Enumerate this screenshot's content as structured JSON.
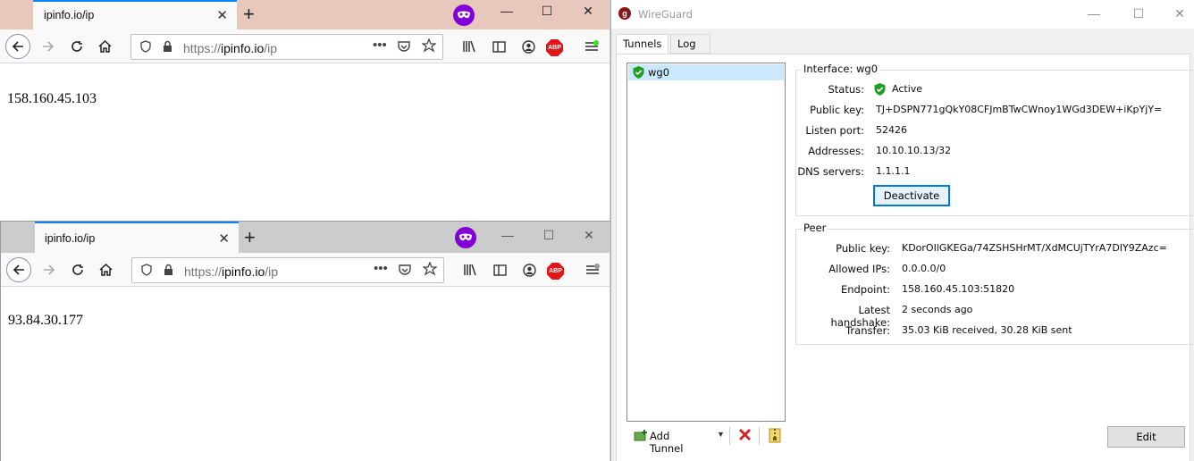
{
  "firefox_top": {
    "tab_title": "ipinfo.io/ip",
    "url_prefix": "https://",
    "url_host": "ipinfo.io",
    "url_path": "/ip",
    "page_content": "158.160.45.103",
    "abp_label": "ABP"
  },
  "firefox_bottom": {
    "tab_title": "ipinfo.io/ip",
    "url_prefix": "https://",
    "url_host": "ipinfo.io",
    "url_path": "/ip",
    "page_content": "93.84.30.177",
    "abp_label": "ABP"
  },
  "wireguard": {
    "title": "WireGuard",
    "tabs": [
      "Tunnels",
      "Log"
    ],
    "tunnels": [
      {
        "name": "wg0",
        "active": true
      }
    ],
    "interface": {
      "title": "Interface: wg0",
      "status_label": "Status:",
      "status_value": "Active",
      "public_key_label": "Public key:",
      "public_key": "TJ+DSPN771gQkY08CFJmBTwCWnoy1WGd3DEW+iKpYjY=",
      "listen_port_label": "Listen port:",
      "listen_port": "52426",
      "addresses_label": "Addresses:",
      "addresses": "10.10.10.13/32",
      "dns_label": "DNS servers:",
      "dns": "1.1.1.1",
      "deactivate_label": "Deactivate"
    },
    "peer": {
      "title": "Peer",
      "public_key_label": "Public key:",
      "public_key": "KDorOIlGKEGa/74ZSHSHrMT/XdMCUjTYrA7DIY9ZAzc=",
      "allowed_ips_label": "Allowed IPs:",
      "allowed_ips": "0.0.0.0/0",
      "endpoint_label": "Endpoint:",
      "endpoint": "158.160.45.103:51820",
      "handshake_label": "Latest handshake:",
      "handshake": "2 seconds ago",
      "transfer_label": "Transfer:",
      "transfer": "35.03 KiB received, 30.28 KiB sent"
    },
    "toolbar": {
      "add_tunnel_label": "Add Tunnel"
    },
    "edit_label": "Edit"
  },
  "colors": {
    "firefox_tabbar_top": "#e8c8bd",
    "firefox_tabbar_bottom": "#cccccc",
    "private_purple": "#8000d7",
    "selection_blue": "#cce8ff",
    "active_green": "#1f9e1f"
  }
}
